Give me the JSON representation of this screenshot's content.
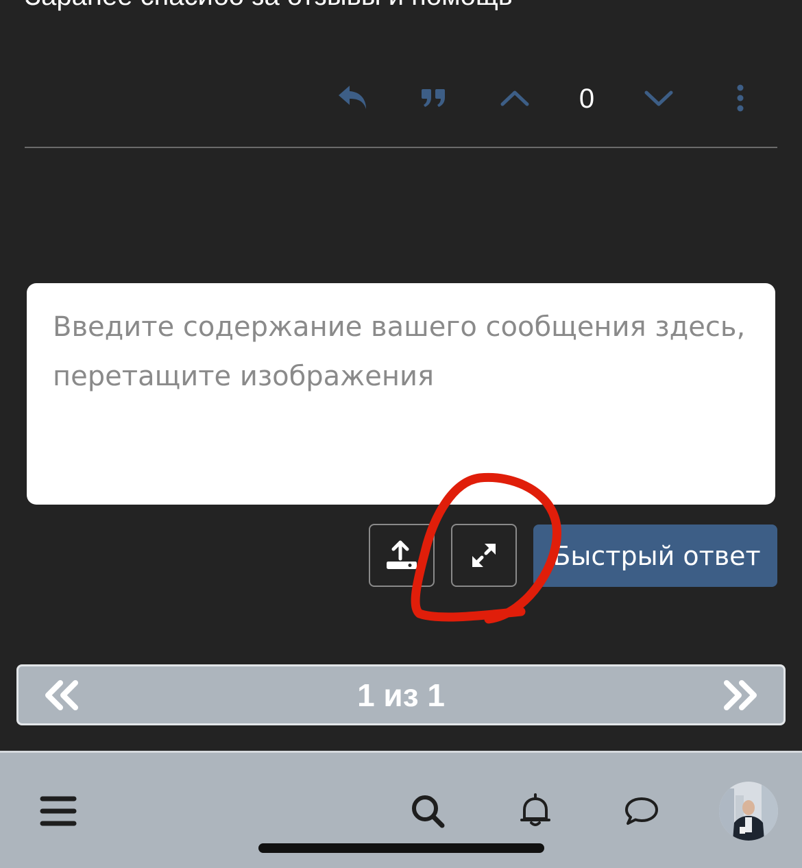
{
  "post": {
    "text": "Заранее спасибо за отзывы и помощь",
    "vote_count": "0"
  },
  "icons": {
    "reply": "reply-icon",
    "quote": "quote-icon",
    "upvote": "chevron-up-icon",
    "downvote": "chevron-down-icon",
    "more": "more-vertical-icon",
    "upload": "upload-icon",
    "expand": "expand-icon",
    "prev": "double-chevron-left-icon",
    "next": "double-chevron-right-icon",
    "menu": "menu-icon",
    "search": "search-icon",
    "notifications": "bell-icon",
    "chat": "chat-bubble-icon"
  },
  "composer": {
    "placeholder": "Введите содержание вашего сообщения здесь, перетащите изображения",
    "value": ""
  },
  "quick_reply": {
    "label": "Быстрый ответ"
  },
  "pagination": {
    "label": "1 из 1"
  },
  "colors": {
    "background": "#232323",
    "accent": "#3d5e86",
    "action_icon": "#3d5e86",
    "bar": "#adb5bd",
    "annotation": "#e01e0a"
  }
}
